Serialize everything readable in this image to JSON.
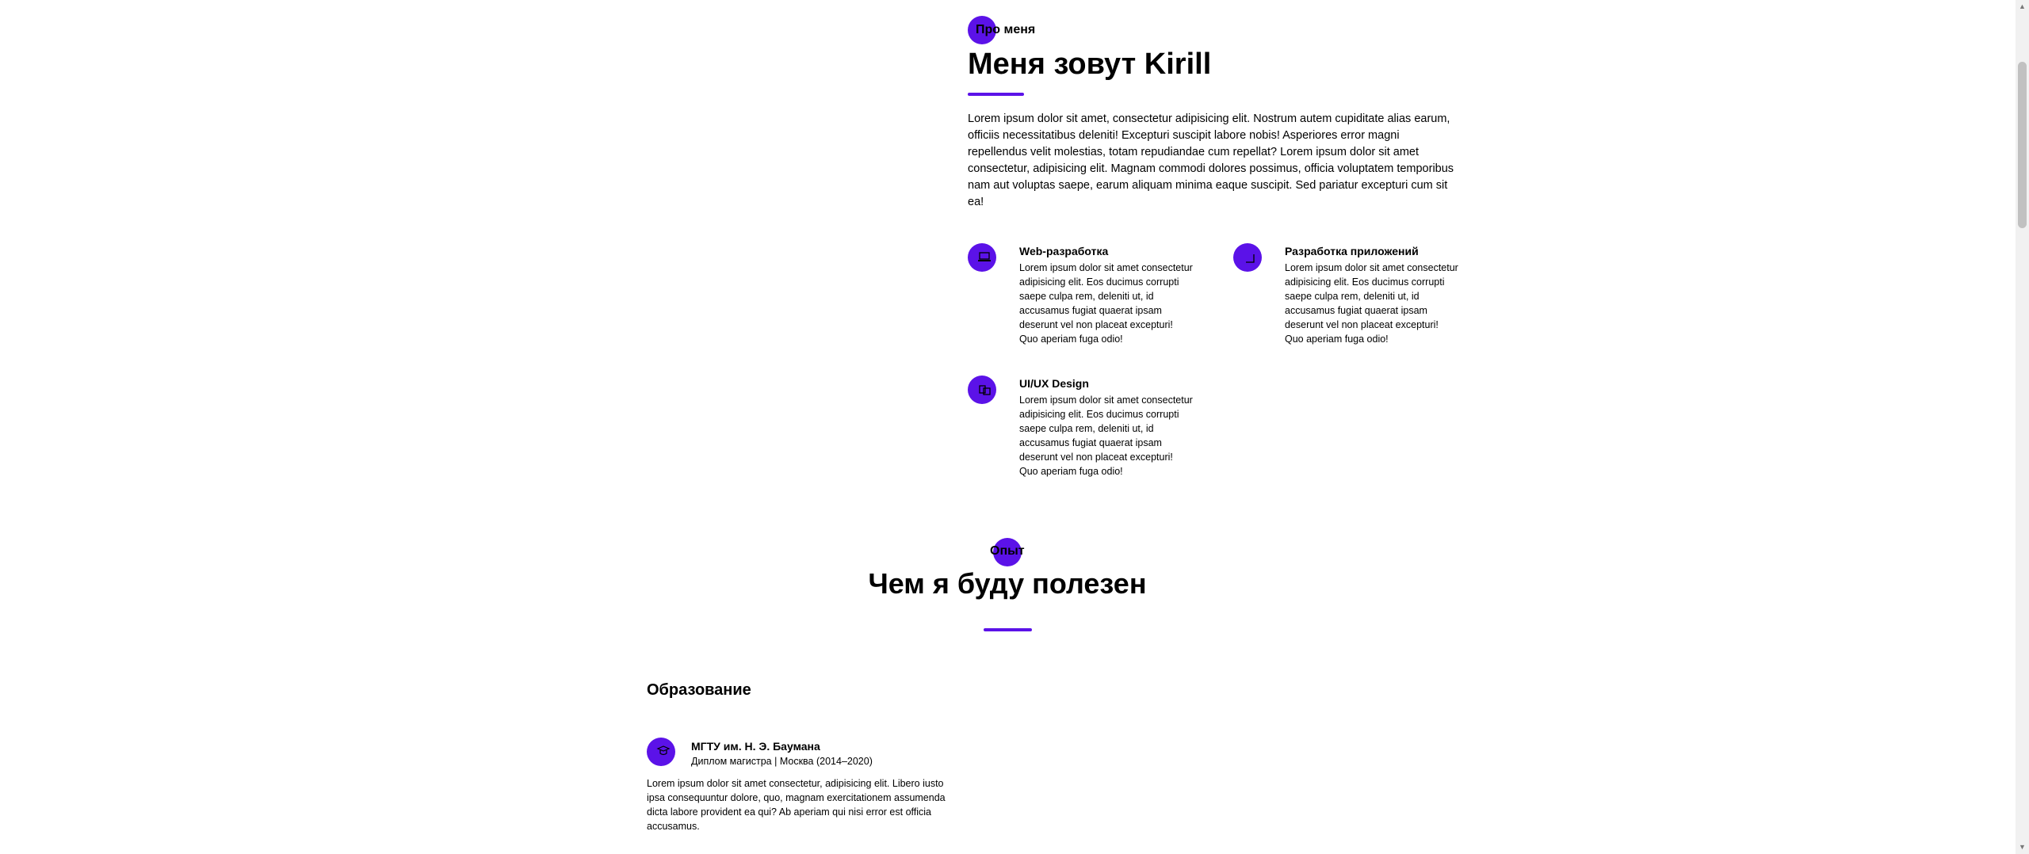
{
  "about": {
    "label": "Про меня",
    "title": "Меня зовут Kirill",
    "text": "Lorem ipsum dolor sit amet, consectetur adipisicing elit. Nostrum autem cupiditate alias earum, officiis necessitatibus deleniti! Excepturi suscipit labore nobis! Asperiores error magni repellendus velit molestias, totam repudiandae cum repellat? Lorem ipsum dolor sit amet consectetur, adipisicing elit. Magnam commodi dolores possimus, officia voluptatem temporibus nam aut voluptas saepe, earum aliquam minima eaque suscipit. Sed pariatur excepturi cum sit ea!",
    "services": [
      {
        "title": "Web-разработка",
        "text": "Lorem ipsum dolor sit amet consectetur adipisicing elit. Eos ducimus corrupti saepe culpa rem, deleniti ut, id accusamus fugiat quaerat ipsam deserunt vel non placeat excepturi! Quo aperiam fuga odio!",
        "icon": "laptop-icon"
      },
      {
        "title": "Разработка приложений",
        "text": "Lorem ipsum dolor sit amet consectetur adipisicing elit. Eos ducimus corrupti saepe culpa rem, deleniti ut, id accusamus fugiat quaerat ipsam deserunt vel non placeat excepturi! Quo aperiam fuga odio!",
        "icon": "mobile-icon"
      },
      {
        "title": "UI/UX Design",
        "text": "Lorem ipsum dolor sit amet consectetur adipisicing elit. Eos ducimus corrupti saepe culpa rem, deleniti ut, id accusamus fugiat quaerat ipsam deserunt vel non placeat excepturi! Quo aperiam fuga odio!",
        "icon": "design-icon"
      }
    ]
  },
  "experience": {
    "label": "Опыт",
    "title": "Чем я буду полезен",
    "education_heading": "Образование",
    "education": [
      {
        "title": "МГТУ им. Н. Э. Баумана",
        "subtitle": "Диплом магистра | Москва (2014–2020)",
        "text": "Lorem ipsum dolor sit amet consectetur, adipisicing elit. Libero iusto ipsa consequuntur dolore, quo, magnam exercitationem assumenda dicta labore provident ea qui? Ab aperiam qui nisi error est officia accusamus.",
        "icon": "graduation-icon"
      }
    ]
  },
  "colors": {
    "accent": "#5b12e8"
  }
}
